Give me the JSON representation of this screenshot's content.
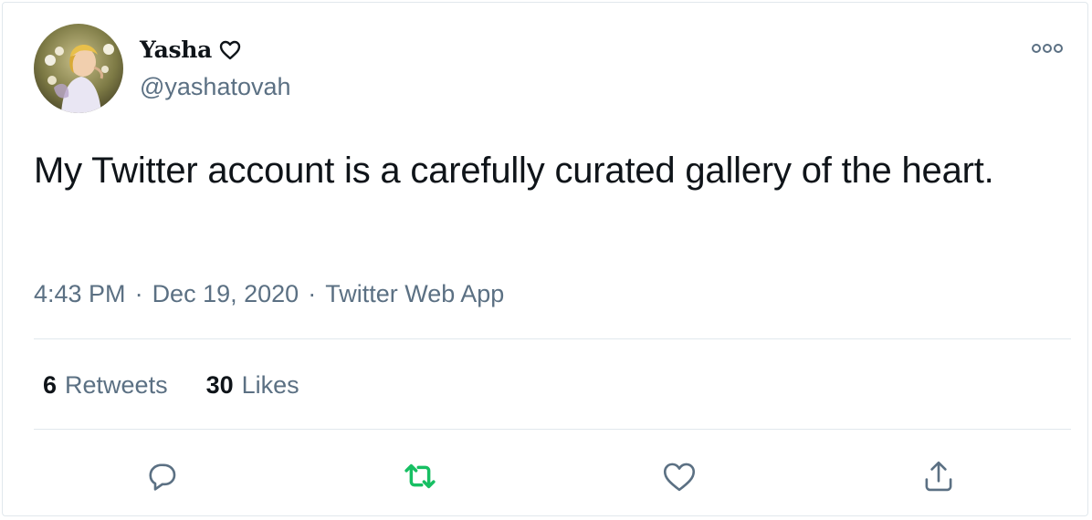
{
  "user": {
    "display_name": "Yasha",
    "handle": "@yashatovah"
  },
  "tweet": {
    "text": "My Twitter account is a carefully curated gallery of the heart.",
    "time": "4:43 PM",
    "date": "Dec 19, 2020",
    "source": "Twitter Web App",
    "separator": "·"
  },
  "stats": {
    "retweets_count": "6",
    "retweets_label": "Retweets",
    "likes_count": "30",
    "likes_label": "Likes"
  },
  "icons": {
    "heart_emoji": "heart-outline-icon",
    "more": "more-horizontal-icon",
    "reply": "reply-icon",
    "retweet": "retweet-icon",
    "like": "like-icon",
    "share": "share-icon"
  },
  "colors": {
    "text_primary": "#0f1419",
    "text_secondary": "#5b7083",
    "retweet_green": "#17bf63",
    "divider": "#e1e8ed"
  }
}
